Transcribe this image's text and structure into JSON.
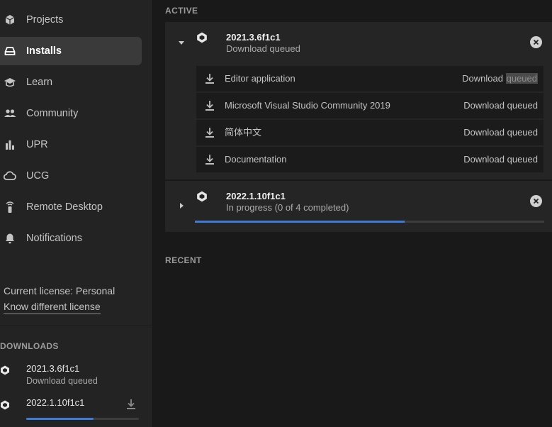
{
  "sidebar": {
    "items": [
      {
        "label": "Projects",
        "icon": "cube-icon"
      },
      {
        "label": "Installs",
        "icon": "drive-icon",
        "active": true
      },
      {
        "label": "Learn",
        "icon": "graduation-cap-icon"
      },
      {
        "label": "Community",
        "icon": "people-icon"
      },
      {
        "label": "UPR",
        "icon": "bar-chart-icon"
      },
      {
        "label": "UCG",
        "icon": "cloud-icon"
      },
      {
        "label": "Remote Desktop",
        "icon": "remote-icon"
      },
      {
        "label": "Notifications",
        "icon": "bell-icon"
      }
    ],
    "license": {
      "current": "Current license: Personal",
      "link": "Know different license"
    },
    "downloads": {
      "title": "DOWNLOADS",
      "items": [
        {
          "name": "2021.3.6f1c1",
          "status": "Download queued"
        },
        {
          "name": "2022.1.10f1c1",
          "progress": 0.6
        }
      ]
    }
  },
  "main": {
    "active_title": "ACTIVE",
    "recent_title": "RECENT",
    "installs": [
      {
        "version": "2021.3.6f1c1",
        "status": "Download queued",
        "expanded": true,
        "components": [
          {
            "name": "Editor application",
            "status_prefix": "Download",
            "status_highlight": "queued"
          },
          {
            "name": "Microsoft Visual Studio Community 2019",
            "status": "Download queued"
          },
          {
            "name": "简体中文",
            "status": "Download queued"
          },
          {
            "name": "Documentation",
            "status": "Download queued"
          }
        ]
      },
      {
        "version": "2022.1.10f1c1",
        "status": "In progress (0 of 4 completed)",
        "expanded": false,
        "progress": 0.6
      }
    ]
  },
  "colors": {
    "accent": "#3f7ad6",
    "sidebar_bg": "#232323",
    "main_bg": "#191919",
    "card_bg": "#252525",
    "row_bg": "#1b1b1b"
  }
}
